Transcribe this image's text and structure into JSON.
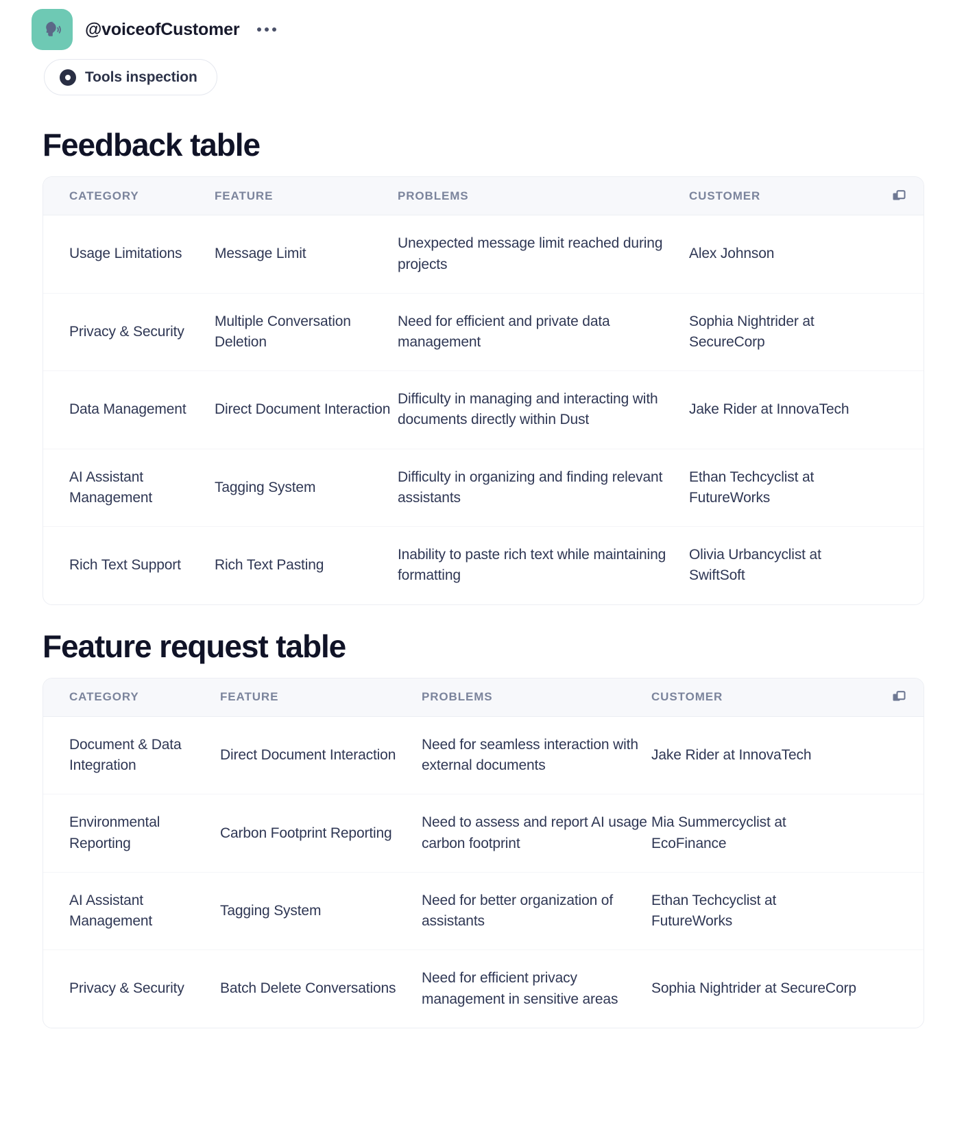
{
  "agent": {
    "handle": "@voiceofCustomer",
    "avatar_icon": "speaking-head-icon",
    "avatar_color": "#6EC9B4",
    "more_menu_label": "•••"
  },
  "tools": {
    "inspection_label": "Tools inspection",
    "icon": "eye-icon"
  },
  "sections": [
    {
      "title": "Feedback table",
      "copy_icon": "copy-icon",
      "columns": [
        "CATEGORY",
        "FEATURE",
        "PROBLEMS",
        "CUSTOMER"
      ],
      "rows": [
        {
          "category": "Usage Limitations",
          "feature": "Message Limit",
          "problems": "Unexpected message limit reached during projects",
          "customer": "Alex Johnson"
        },
        {
          "category": "Privacy & Security",
          "feature": "Multiple Conversation Deletion",
          "problems": "Need for efficient and private data management",
          "customer": "Sophia Nightrider at SecureCorp"
        },
        {
          "category": "Data Management",
          "feature": "Direct Document Interaction",
          "problems": "Difficulty in managing and interacting with documents directly within Dust",
          "customer": "Jake Rider at InnovaTech"
        },
        {
          "category": "AI Assistant Management",
          "feature": "Tagging System",
          "problems": "Difficulty in organizing and finding relevant assistants",
          "customer": "Ethan Techcyclist at FutureWorks"
        },
        {
          "category": "Rich Text Support",
          "feature": "Rich Text Pasting",
          "problems": "Inability to paste rich text while maintaining formatting",
          "customer": "Olivia Urbancyclist at SwiftSoft"
        }
      ]
    },
    {
      "title": "Feature request table",
      "copy_icon": "copy-icon",
      "columns": [
        "CATEGORY",
        "FEATURE",
        "PROBLEMS",
        "CUSTOMER"
      ],
      "rows": [
        {
          "category": "Document & Data Integration",
          "feature": "Direct Document Interaction",
          "problems": "Need for seamless interaction with external documents",
          "customer": "Jake Rider at InnovaTech"
        },
        {
          "category": "Environmental Reporting",
          "feature": "Carbon Footprint Reporting",
          "problems": "Need to assess and report AI usage carbon footprint",
          "customer": "Mia Summercyclist at EcoFinance"
        },
        {
          "category": "AI Assistant Management",
          "feature": "Tagging System",
          "problems": "Need for better organization of assistants",
          "customer": "Ethan Techcyclist at FutureWorks"
        },
        {
          "category": "Privacy & Security",
          "feature": "Batch Delete Conversations",
          "problems": "Need for efficient privacy management in sensitive areas",
          "customer": "Sophia Nightrider at SecureCorp"
        }
      ]
    }
  ]
}
